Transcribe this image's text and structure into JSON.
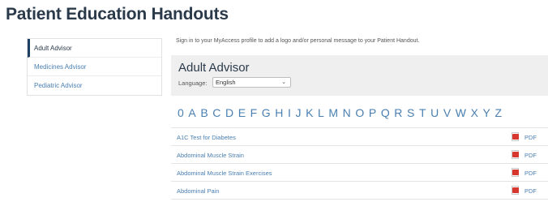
{
  "page": {
    "title": "Patient Education Handouts"
  },
  "sidebar": {
    "items": [
      {
        "label": "Adult Advisor",
        "active": true
      },
      {
        "label": "Medicines Advisor",
        "active": false
      },
      {
        "label": "Pediatric Advisor",
        "active": false
      }
    ]
  },
  "signin_text": "Sign in to your MyAccess profile to add a logo and/or personal message to your Patient Handout.",
  "advisor": {
    "title": "Adult Advisor",
    "language_label": "Language:",
    "language_value": "English"
  },
  "alphabet": [
    "0",
    "A",
    "B",
    "C",
    "D",
    "E",
    "F",
    "G",
    "H",
    "I",
    "J",
    "K",
    "L",
    "M",
    "N",
    "O",
    "P",
    "Q",
    "R",
    "S",
    "T",
    "U",
    "V",
    "W",
    "X",
    "Y",
    "Z"
  ],
  "handouts": [
    {
      "title": "A1C Test for Diabetes",
      "link": "PDF"
    },
    {
      "title": "Abdominal Muscle Strain",
      "link": "PDF"
    },
    {
      "title": "Abdominal Muscle Strain Exercises",
      "link": "PDF"
    },
    {
      "title": "Abdominal Pain",
      "link": "PDF"
    }
  ],
  "colors": {
    "link": "#4a7fb0",
    "heading": "#2b3a4a",
    "pdf_icon": "#d8372f",
    "panel": "#efefef"
  }
}
